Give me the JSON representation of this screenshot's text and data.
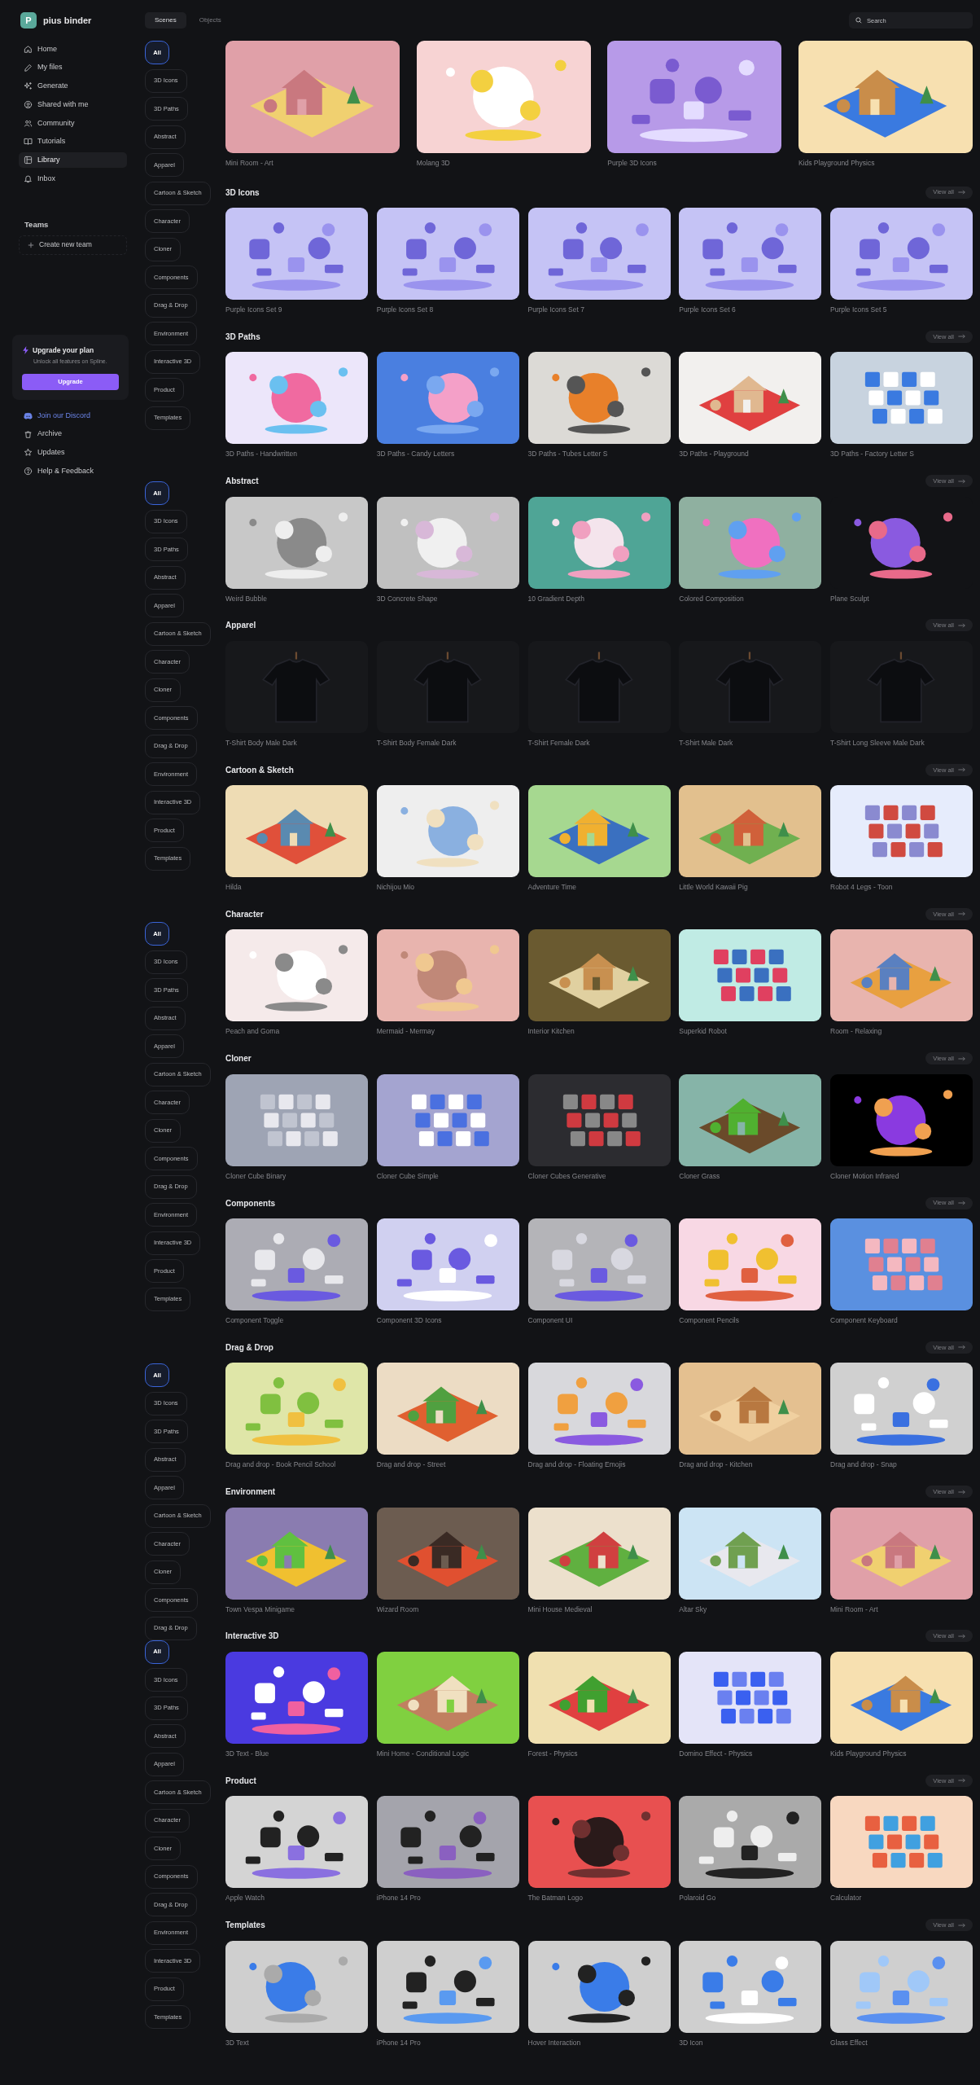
{
  "user": {
    "initial": "P",
    "name": "pius binder"
  },
  "nav": [
    {
      "label": "Home",
      "kind": "home",
      "selected": false
    },
    {
      "label": "My files",
      "kind": "files",
      "selected": false
    },
    {
      "label": "Generate",
      "kind": "generate",
      "selected": false
    },
    {
      "label": "Shared with me",
      "kind": "shared",
      "selected": false
    },
    {
      "label": "Community",
      "kind": "community",
      "selected": false
    },
    {
      "label": "Tutorials",
      "kind": "tutorials",
      "selected": false
    },
    {
      "label": "Library",
      "kind": "library",
      "selected": true
    },
    {
      "label": "Inbox",
      "kind": "inbox",
      "selected": false
    }
  ],
  "teams": {
    "title": "Teams",
    "create": "Create new team"
  },
  "upgrade": {
    "title": "Upgrade your plan",
    "description": "Unlock all features on Spline.",
    "button": "Upgrade"
  },
  "bottom_links": [
    {
      "label": "Join our Discord",
      "kind": "discord"
    },
    {
      "label": "Archive",
      "kind": "archive"
    },
    {
      "label": "Updates",
      "kind": "updates"
    },
    {
      "label": "Help & Feedback",
      "kind": "help"
    }
  ],
  "tabs": [
    {
      "label": "Scenes",
      "selected": true
    },
    {
      "label": "Objects",
      "selected": false
    }
  ],
  "search": {
    "placeholder": "Search"
  },
  "filter_groups": [
    {
      "items": [
        {
          "label": "All",
          "selected": true
        },
        {
          "label": "3D Icons",
          "selected": false
        },
        {
          "label": "3D Paths",
          "selected": false
        },
        {
          "label": "Abstract",
          "selected": false
        },
        {
          "label": "Apparel",
          "selected": false
        },
        {
          "label": "Cartoon & Sketch",
          "selected": false
        },
        {
          "label": "Character",
          "selected": false
        },
        {
          "label": "Cloner",
          "selected": false
        },
        {
          "label": "Components",
          "selected": false
        },
        {
          "label": "Drag & Drop",
          "selected": false
        },
        {
          "label": "Environment",
          "selected": false
        },
        {
          "label": "Interactive 3D",
          "selected": false
        },
        {
          "label": "Product",
          "selected": false
        },
        {
          "label": "Templates",
          "selected": false
        }
      ]
    },
    {
      "items": [
        {
          "label": "All",
          "selected": true
        },
        {
          "label": "3D Icons",
          "selected": false
        },
        {
          "label": "3D Paths",
          "selected": false
        },
        {
          "label": "Abstract",
          "selected": false
        },
        {
          "label": "Apparel",
          "selected": false
        },
        {
          "label": "Cartoon & Sketch",
          "selected": false
        },
        {
          "label": "Character",
          "selected": false
        },
        {
          "label": "Cloner",
          "selected": false
        },
        {
          "label": "Components",
          "selected": false
        },
        {
          "label": "Drag & Drop",
          "selected": false
        },
        {
          "label": "Environment",
          "selected": false
        },
        {
          "label": "Interactive 3D",
          "selected": false
        },
        {
          "label": "Product",
          "selected": false
        },
        {
          "label": "Templates",
          "selected": false
        }
      ]
    },
    {
      "items": [
        {
          "label": "All",
          "selected": true
        },
        {
          "label": "3D Icons",
          "selected": false
        },
        {
          "label": "3D Paths",
          "selected": false
        },
        {
          "label": "Abstract",
          "selected": false
        },
        {
          "label": "Apparel",
          "selected": false
        },
        {
          "label": "Cartoon & Sketch",
          "selected": false
        },
        {
          "label": "Character",
          "selected": false
        },
        {
          "label": "Cloner",
          "selected": false
        },
        {
          "label": "Components",
          "selected": false
        },
        {
          "label": "Drag & Drop",
          "selected": false
        },
        {
          "label": "Environment",
          "selected": false
        },
        {
          "label": "Interactive 3D",
          "selected": false
        },
        {
          "label": "Product",
          "selected": false
        },
        {
          "label": "Templates",
          "selected": false
        }
      ]
    },
    {
      "items": [
        {
          "label": "All",
          "selected": true
        },
        {
          "label": "3D Icons",
          "selected": false
        },
        {
          "label": "3D Paths",
          "selected": false
        },
        {
          "label": "Abstract",
          "selected": false
        },
        {
          "label": "Apparel",
          "selected": false
        },
        {
          "label": "Cartoon & Sketch",
          "selected": false
        },
        {
          "label": "Character",
          "selected": false
        },
        {
          "label": "Cloner",
          "selected": false
        },
        {
          "label": "Components",
          "selected": false
        },
        {
          "label": "Drag & Drop",
          "selected": false
        }
      ]
    },
    {
      "items": [
        {
          "label": "All",
          "selected": true
        },
        {
          "label": "3D Icons",
          "selected": false
        },
        {
          "label": "3D Paths",
          "selected": false
        },
        {
          "label": "Abstract",
          "selected": false
        },
        {
          "label": "Apparel",
          "selected": false
        },
        {
          "label": "Cartoon & Sketch",
          "selected": false
        },
        {
          "label": "Character",
          "selected": false
        },
        {
          "label": "Cloner",
          "selected": false
        },
        {
          "label": "Components",
          "selected": false
        },
        {
          "label": "Drag & Drop",
          "selected": false
        },
        {
          "label": "Environment",
          "selected": false
        },
        {
          "label": "Interactive 3D",
          "selected": false
        },
        {
          "label": "Product",
          "selected": false
        },
        {
          "label": "Templates",
          "selected": false
        }
      ]
    }
  ],
  "featured": [
    {
      "title": "Mini Room - Art",
      "kind": "picture"
    },
    {
      "title": "Molang 3D",
      "kind": "picture"
    },
    {
      "title": "Purple 3D Icons",
      "kind": "picture"
    },
    {
      "title": "Kids Playground Physics",
      "kind": "picture"
    }
  ],
  "sections": [
    {
      "title": "3D Icons",
      "view_all": "View all",
      "cards": [
        {
          "title": "Purple Icons Set 9"
        },
        {
          "title": "Purple Icons Set 8"
        },
        {
          "title": "Purple Icons Set 7"
        },
        {
          "title": "Purple Icons Set 6"
        },
        {
          "title": "Purple Icons Set 5"
        }
      ]
    },
    {
      "title": "3D Paths",
      "view_all": "View all",
      "cards": [
        {
          "title": "3D Paths - Handwritten"
        },
        {
          "title": "3D Paths - Candy Letters"
        },
        {
          "title": "3D Paths - Tubes Letter S"
        },
        {
          "title": "3D Paths - Playground"
        },
        {
          "title": "3D Paths - Factory Letter S"
        }
      ]
    },
    {
      "title": "Abstract",
      "view_all": "View all",
      "cards": [
        {
          "title": "Weird Bubble"
        },
        {
          "title": "3D Concrete Shape"
        },
        {
          "title": "10 Gradient Depth"
        },
        {
          "title": "Colored Composition"
        },
        {
          "title": "Plane Sculpt"
        }
      ]
    },
    {
      "title": "Apparel",
      "view_all": "View all",
      "cards": [
        {
          "title": "T-Shirt Body Male Dark"
        },
        {
          "title": "T-Shirt Body Female Dark"
        },
        {
          "title": "T-Shirt Female Dark"
        },
        {
          "title": "T-Shirt Male Dark"
        },
        {
          "title": "T-Shirt Long Sleeve Male Dark"
        }
      ]
    },
    {
      "title": "Cartoon & Sketch",
      "view_all": "View all",
      "cards": [
        {
          "title": "Hilda"
        },
        {
          "title": "Nichijou Mio"
        },
        {
          "title": "Adventure Time"
        },
        {
          "title": "Little World Kawaii Pig"
        },
        {
          "title": "Robot 4 Legs - Toon"
        }
      ]
    },
    {
      "title": "Character",
      "view_all": "View all",
      "cards": [
        {
          "title": "Peach and Goma"
        },
        {
          "title": "Mermaid - Mermay"
        },
        {
          "title": "Interior Kitchen"
        },
        {
          "title": "Superkid Robot"
        },
        {
          "title": "Room - Relaxing"
        }
      ]
    },
    {
      "title": "Cloner",
      "view_all": "View all",
      "cards": [
        {
          "title": "Cloner Cube Binary"
        },
        {
          "title": "Cloner Cube Simple"
        },
        {
          "title": "Cloner Cubes Generative"
        },
        {
          "title": "Cloner Grass"
        },
        {
          "title": "Cloner Motion Infrared"
        }
      ]
    },
    {
      "title": "Components",
      "view_all": "View all",
      "cards": [
        {
          "title": "Component Toggle"
        },
        {
          "title": "Component 3D Icons"
        },
        {
          "title": "Component UI"
        },
        {
          "title": "Component Pencils"
        },
        {
          "title": "Component Keyboard"
        }
      ]
    },
    {
      "title": "Drag & Drop",
      "view_all": "View all",
      "cards": [
        {
          "title": "Drag and drop - Book Pencil School"
        },
        {
          "title": "Drag and drop - Street"
        },
        {
          "title": "Drag and drop - Floating Emojis"
        },
        {
          "title": "Drag and drop - Kitchen"
        },
        {
          "title": "Drag and drop - Snap"
        }
      ]
    },
    {
      "title": "Environment",
      "view_all": "View all",
      "cards": [
        {
          "title": "Town Vespa Minigame"
        },
        {
          "title": "Wizard Room"
        },
        {
          "title": "Mini House Medieval"
        },
        {
          "title": "Altar Sky"
        },
        {
          "title": "Mini Room - Art"
        }
      ]
    },
    {
      "title": "Interactive 3D",
      "view_all": "View all",
      "cards": [
        {
          "title": "3D Text - Blue"
        },
        {
          "title": "Mini Home - Conditional Logic"
        },
        {
          "title": "Forest - Physics"
        },
        {
          "title": "Domino Effect - Physics"
        },
        {
          "title": "Kids Playground Physics"
        }
      ]
    },
    {
      "title": "Product",
      "view_all": "View all",
      "cards": [
        {
          "title": "Apple Watch"
        },
        {
          "title": "iPhone 14 Pro"
        },
        {
          "title": "The Batman Logo"
        },
        {
          "title": "Polaroid Go"
        },
        {
          "title": "Calculator"
        }
      ]
    },
    {
      "title": "Templates",
      "view_all": "View all",
      "cards": [
        {
          "title": "3D Text"
        },
        {
          "title": "iPhone 14 Pro"
        },
        {
          "title": "Hover Interaction"
        },
        {
          "title": "3D Icon"
        },
        {
          "title": "Glass Effect"
        }
      ]
    }
  ]
}
